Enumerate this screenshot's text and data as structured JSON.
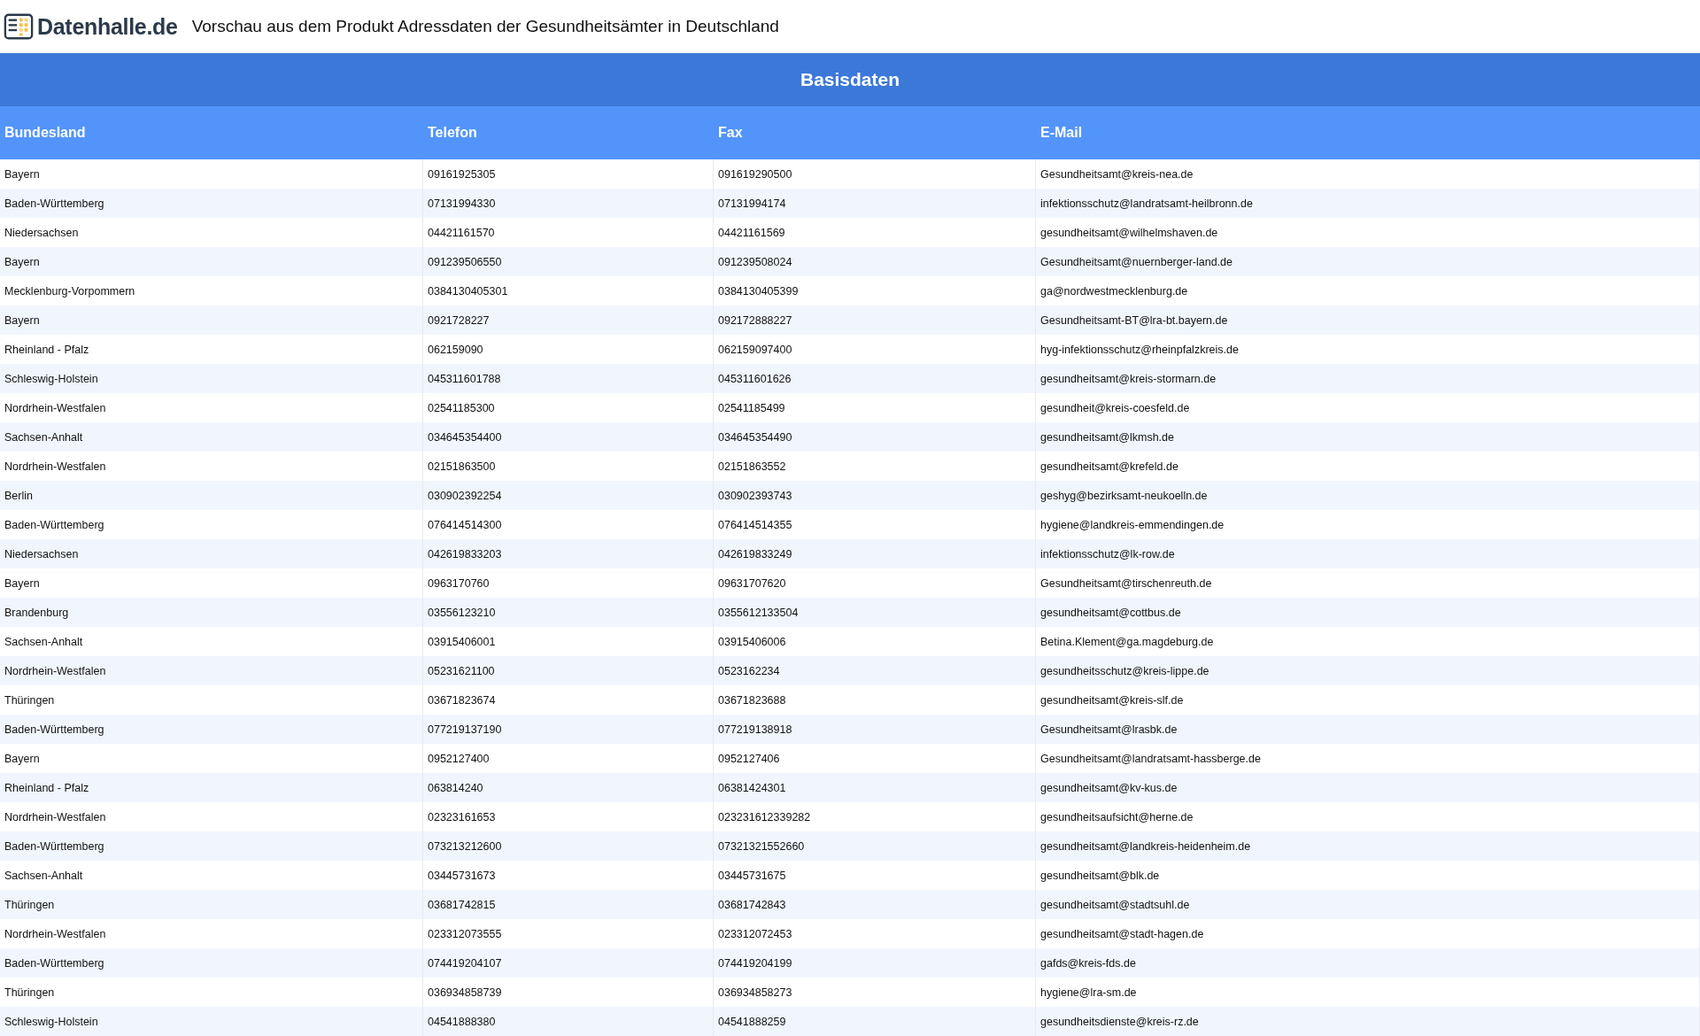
{
  "brand": {
    "name": "Datenhalle.de"
  },
  "page_title": "Vorschau aus dem Produkt Adressdaten der Gesundheitsämter in Deutschland",
  "table": {
    "title": "Basisdaten",
    "columns": [
      "Bundesland",
      "Telefon",
      "Fax",
      "E-Mail"
    ],
    "rows": [
      [
        "Bayern",
        "09161925305",
        "091619290500",
        "Gesundheitsamt@kreis-nea.de"
      ],
      [
        "Baden-Württemberg",
        "07131994330",
        "07131994174",
        "infektionsschutz@landratsamt-heilbronn.de"
      ],
      [
        "Niedersachsen",
        "04421161570",
        "04421161569",
        "gesundheitsamt@wilhelmshaven.de"
      ],
      [
        "Bayern",
        "091239506550",
        "091239508024",
        "Gesundheitsamt@nuernberger-land.de"
      ],
      [
        "Mecklenburg-Vorpommern",
        "0384130405301",
        "0384130405399",
        "ga@nordwestmecklenburg.de"
      ],
      [
        "Bayern",
        "0921728227",
        "092172888227",
        "Gesundheitsamt-BT@lra-bt.bayern.de"
      ],
      [
        "Rheinland - Pfalz",
        "062159090",
        "062159097400",
        "hyg-infektionsschutz@rheinpfalzkreis.de"
      ],
      [
        "Schleswig-Holstein",
        "045311601788",
        "045311601626",
        "gesundheitsamt@kreis-stormarn.de"
      ],
      [
        "Nordrhein-Westfalen",
        "02541185300",
        "02541185499",
        "gesundheit@kreis-coesfeld.de"
      ],
      [
        "Sachsen-Anhalt",
        "034645354400",
        "034645354490",
        "gesundheitsamt@lkmsh.de"
      ],
      [
        "Nordrhein-Westfalen",
        "02151863500",
        "02151863552",
        "gesundheitsamt@krefeld.de"
      ],
      [
        "Berlin",
        "030902392254",
        "030902393743",
        "geshyg@bezirksamt-neukoelln.de"
      ],
      [
        "Baden-Württemberg",
        "076414514300",
        "076414514355",
        "hygiene@landkreis-emmendingen.de"
      ],
      [
        "Niedersachsen",
        "042619833203",
        "042619833249",
        "infektionsschutz@lk-row.de"
      ],
      [
        "Bayern",
        "0963170760",
        "09631707620",
        "Gesundheitsamt@tirschenreuth.de"
      ],
      [
        "Brandenburg",
        "03556123210",
        "0355612133504",
        "gesundheitsamt@cottbus.de"
      ],
      [
        "Sachsen-Anhalt",
        "03915406001",
        "03915406006",
        "Betina.Klement@ga.magdeburg.de"
      ],
      [
        "Nordrhein-Westfalen",
        "05231621100",
        "0523162234",
        "gesundheitsschutz@kreis-lippe.de"
      ],
      [
        "Thüringen",
        "03671823674",
        "03671823688",
        "gesundheitsamt@kreis-slf.de"
      ],
      [
        "Baden-Württemberg",
        "077219137190",
        "077219138918",
        "Gesundheitsamt@lrasbk.de"
      ],
      [
        "Bayern",
        "0952127400",
        "0952127406",
        "Gesundheitsamt@landratsamt-hassberge.de"
      ],
      [
        "Rheinland - Pfalz",
        "063814240",
        "06381424301",
        "gesundheitsamt@kv-kus.de"
      ],
      [
        "Nordrhein-Westfalen",
        "02323161653",
        "023231612339282",
        "gesundheitsaufsicht@herne.de"
      ],
      [
        "Baden-Württemberg",
        "073213212600",
        "07321321552660",
        "gesundheitsamt@landkreis-heidenheim.de"
      ],
      [
        "Sachsen-Anhalt",
        "03445731673",
        "03445731675",
        "gesundheitsamt@blk.de"
      ],
      [
        "Thüringen",
        "03681742815",
        "03681742843",
        "gesundheitsamt@stadtsuhl.de"
      ],
      [
        "Nordrhein-Westfalen",
        "023312073555",
        "023312072453",
        "gesundheitsamt@stadt-hagen.de"
      ],
      [
        "Baden-Württemberg",
        "074419204107",
        "074419204199",
        "gafds@kreis-fds.de"
      ],
      [
        "Thüringen",
        "036934858739",
        "036934858273",
        "hygiene@lra-sm.de"
      ],
      [
        "Schleswig-Holstein",
        "04541888380",
        "04541888259",
        "gesundheitsdienste@kreis-rz.de"
      ]
    ]
  }
}
